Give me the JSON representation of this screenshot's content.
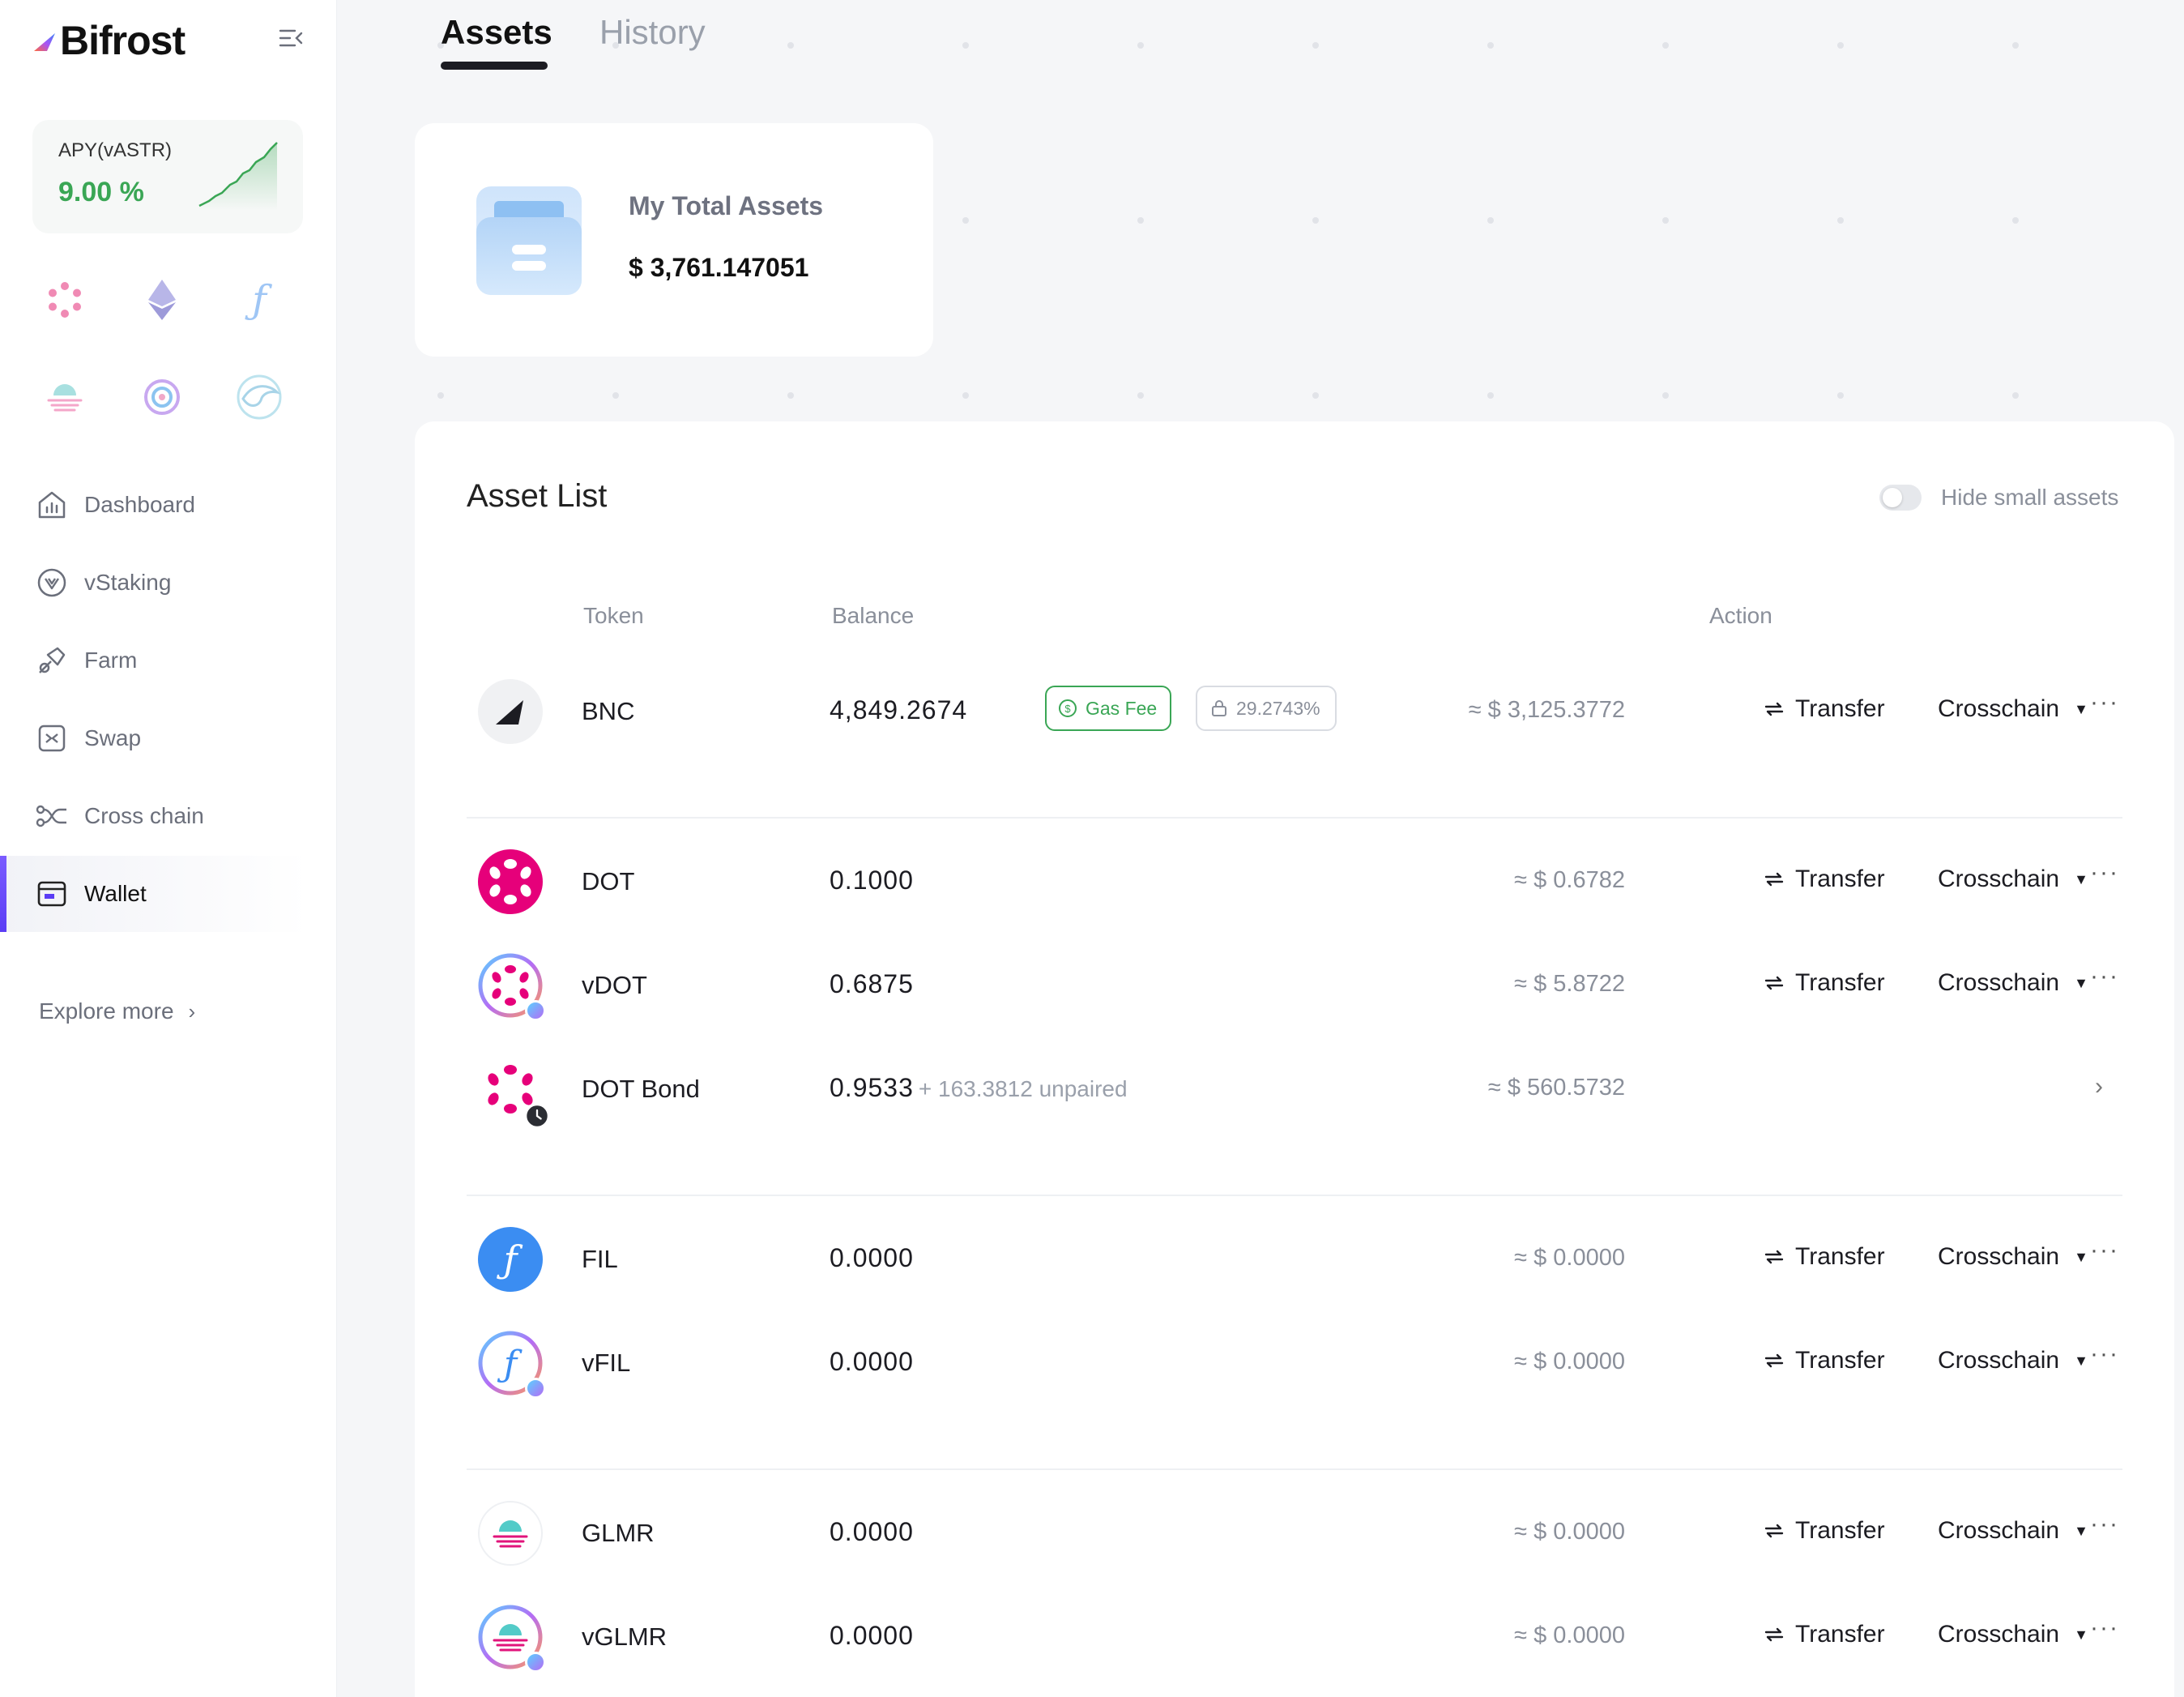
{
  "brand": {
    "name": "Bifrost"
  },
  "apy": {
    "label": "APY(vASTR)",
    "value": "9.00 %"
  },
  "chains": [
    "polkadot-icon",
    "ethereum-icon",
    "filecoin-icon",
    "moonbeam-icon",
    "astar-icon",
    "kusama-swallow-icon"
  ],
  "nav": {
    "items": [
      {
        "label": "Dashboard",
        "icon": "dashboard-icon"
      },
      {
        "label": "vStaking",
        "icon": "vstaking-icon"
      },
      {
        "label": "Farm",
        "icon": "farm-icon"
      },
      {
        "label": "Swap",
        "icon": "swap-icon"
      },
      {
        "label": "Cross chain",
        "icon": "cross-chain-icon"
      },
      {
        "label": "Wallet",
        "icon": "wallet-icon",
        "active": true
      }
    ],
    "explore": "Explore more"
  },
  "tabs": {
    "assets": "Assets",
    "history": "History",
    "active": "Assets"
  },
  "total": {
    "label": "My Total Assets",
    "value": "$ 3,761.147051"
  },
  "asset_list": {
    "title": "Asset List",
    "hide_small_label": "Hide small assets",
    "hide_small_enabled": false,
    "columns": {
      "token": "Token",
      "balance": "Balance",
      "action": "Action"
    },
    "rows": [
      {
        "token": "BNC",
        "balance": "4,849.2674",
        "gas_fee_label": "Gas Fee",
        "locked": "29.2743%",
        "usd": "≈ $ 3,125.3772",
        "transfer": "Transfer",
        "crosschain": "Crosschain"
      },
      {
        "token": "DOT",
        "balance": "0.1000",
        "usd": "≈ $ 0.6782",
        "transfer": "Transfer",
        "crosschain": "Crosschain"
      },
      {
        "token": "vDOT",
        "balance": "0.6875",
        "usd": "≈ $ 5.8722",
        "transfer": "Transfer",
        "crosschain": "Crosschain"
      },
      {
        "token": "DOT Bond",
        "balance": "0.9533",
        "balance_extra": "+ 163.3812 unpaired",
        "usd": "≈ $ 560.5732"
      },
      {
        "token": "FIL",
        "balance": "0.0000",
        "usd": "≈ $ 0.0000",
        "transfer": "Transfer",
        "crosschain": "Crosschain"
      },
      {
        "token": "vFIL",
        "balance": "0.0000",
        "usd": "≈ $ 0.0000",
        "transfer": "Transfer",
        "crosschain": "Crosschain"
      },
      {
        "token": "GLMR",
        "balance": "0.0000",
        "usd": "≈ $ 0.0000",
        "transfer": "Transfer",
        "crosschain": "Crosschain"
      },
      {
        "token": "vGLMR",
        "balance": "0.0000",
        "usd": "≈ $ 0.0000",
        "transfer": "Transfer",
        "crosschain": "Crosschain"
      }
    ]
  },
  "colors": {
    "accent": "#5b3df5",
    "green": "#3aa655",
    "polkadot": "#e6007a",
    "filecoin": "#0090ff"
  }
}
